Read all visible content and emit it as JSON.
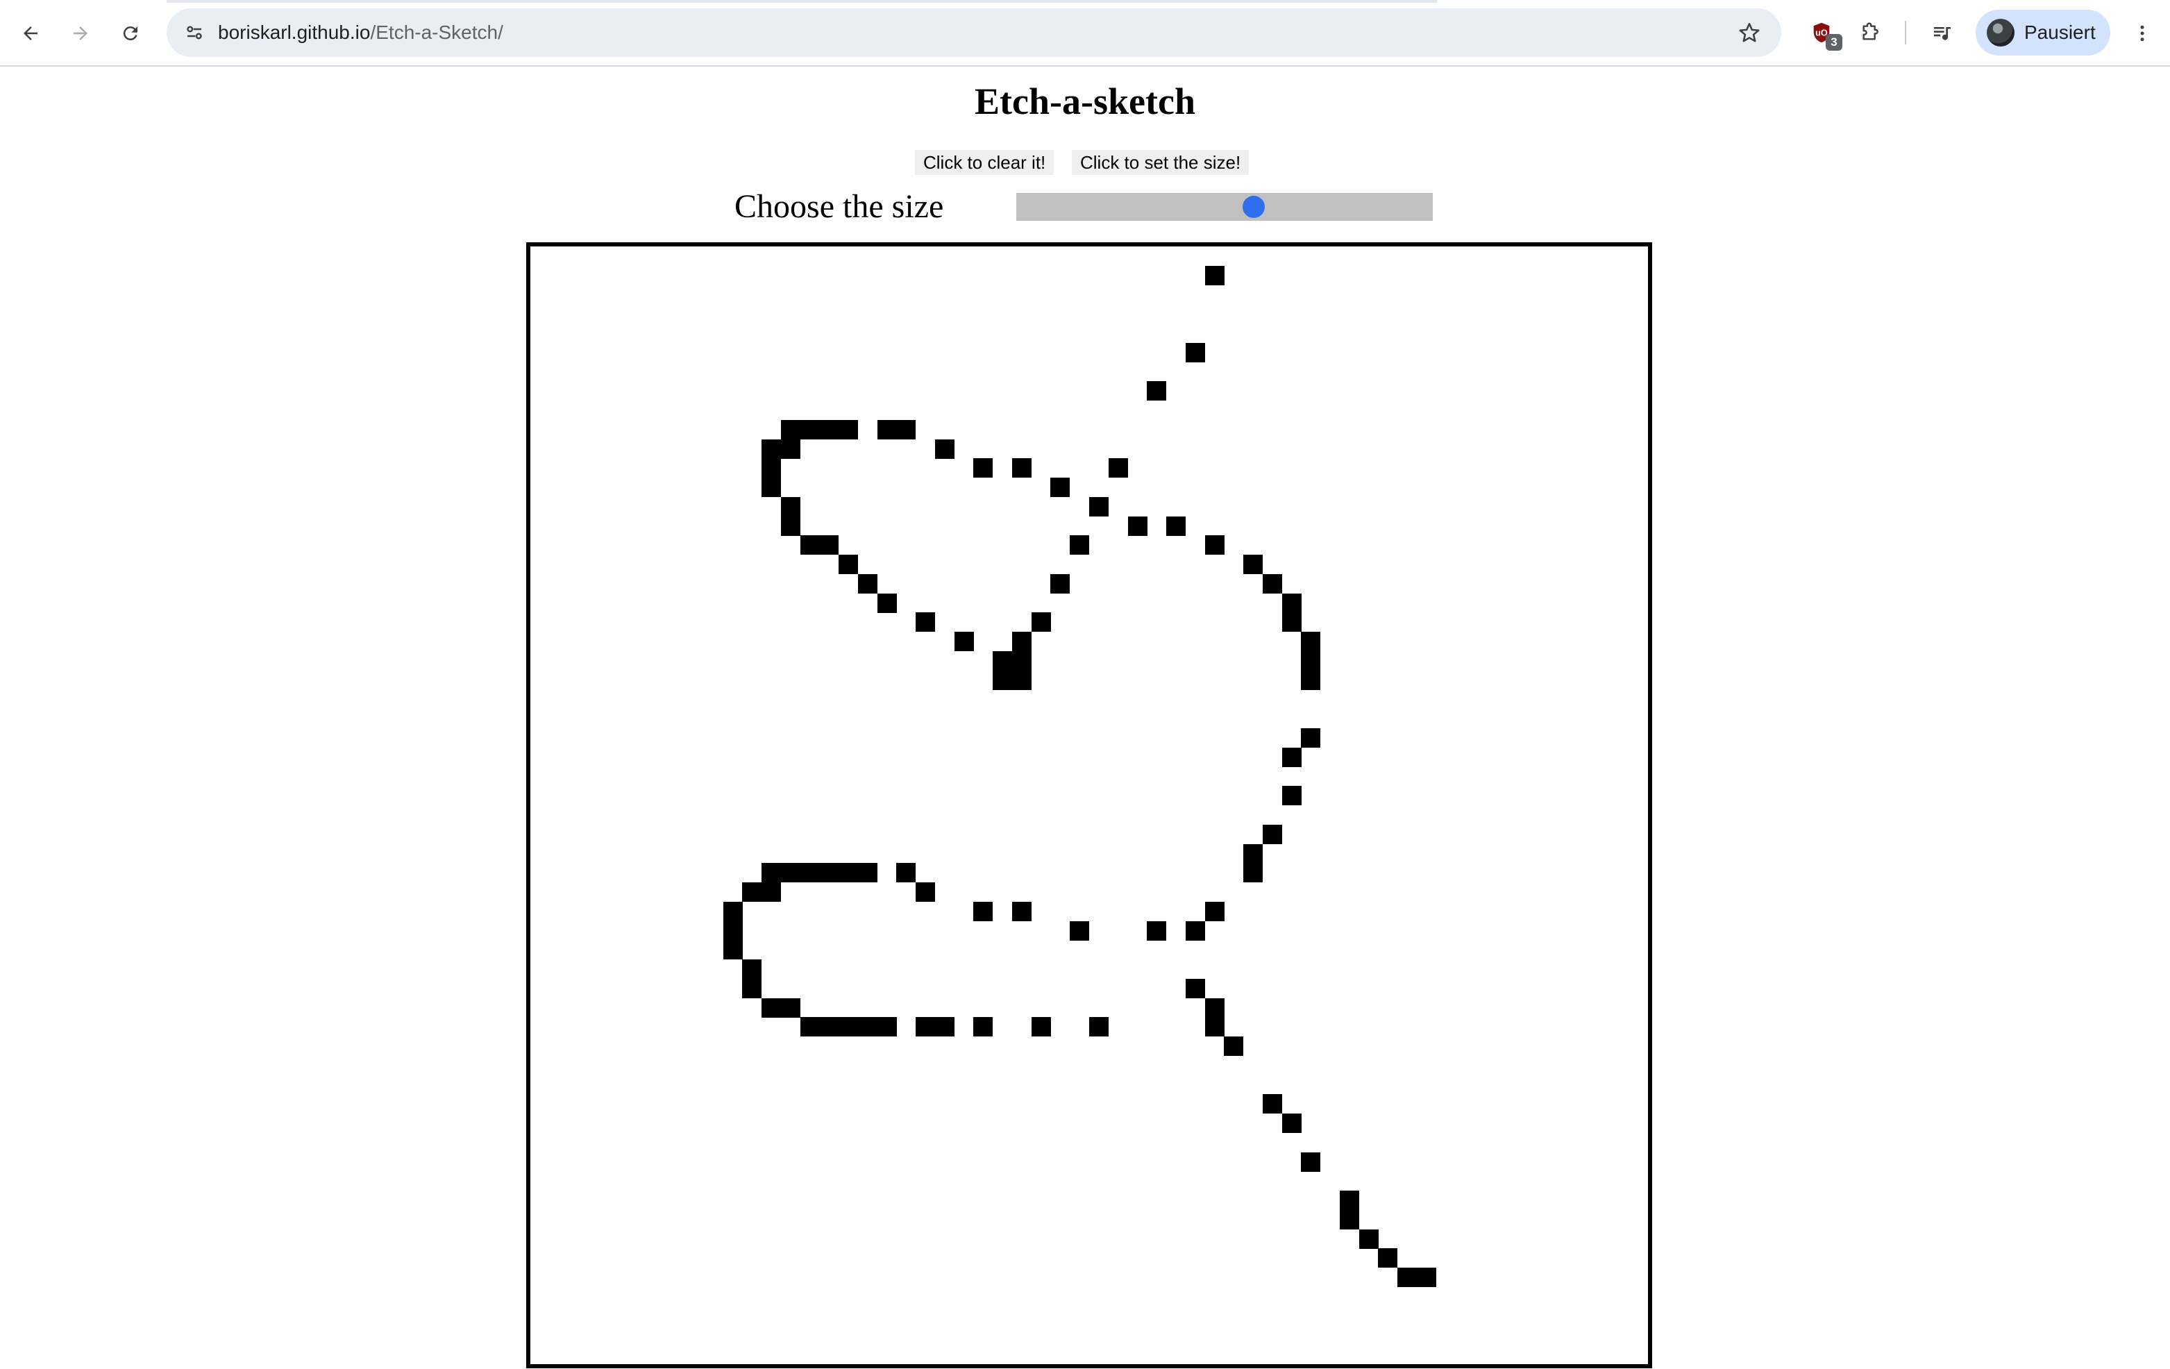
{
  "browser": {
    "url_host": "boriskarl.github.io",
    "url_path": "/Etch-a-Sketch/",
    "extension_badge": "3",
    "profile_name": "Pausiert"
  },
  "page": {
    "title": "Etch-a-sketch",
    "clear_button": "Click to clear it!",
    "set_size_button": "Click to set the size!",
    "size_label": "Choose the size",
    "slider_fraction": 0.57
  },
  "sketch": {
    "grid_size": 58,
    "filled_cells": [
      [
        35,
        1
      ],
      [
        34,
        5
      ],
      [
        32,
        7
      ],
      [
        13,
        9
      ],
      [
        14,
        9
      ],
      [
        15,
        9
      ],
      [
        16,
        9
      ],
      [
        18,
        9
      ],
      [
        19,
        9
      ],
      [
        12,
        10
      ],
      [
        13,
        10
      ],
      [
        21,
        10
      ],
      [
        12,
        11
      ],
      [
        23,
        11
      ],
      [
        25,
        11
      ],
      [
        30,
        11
      ],
      [
        12,
        12
      ],
      [
        27,
        12
      ],
      [
        13,
        13
      ],
      [
        29,
        13
      ],
      [
        31,
        14
      ],
      [
        33,
        14
      ],
      [
        13,
        14
      ],
      [
        14,
        15
      ],
      [
        15,
        15
      ],
      [
        28,
        15
      ],
      [
        35,
        15
      ],
      [
        16,
        16
      ],
      [
        37,
        16
      ],
      [
        17,
        17
      ],
      [
        27,
        17
      ],
      [
        38,
        17
      ],
      [
        18,
        18
      ],
      [
        39,
        18
      ],
      [
        20,
        19
      ],
      [
        26,
        19
      ],
      [
        39,
        19
      ],
      [
        22,
        20
      ],
      [
        25,
        20
      ],
      [
        40,
        20
      ],
      [
        24,
        21
      ],
      [
        25,
        21
      ],
      [
        40,
        21
      ],
      [
        24,
        22
      ],
      [
        25,
        22
      ],
      [
        40,
        22
      ],
      [
        40,
        25
      ],
      [
        39,
        26
      ],
      [
        39,
        28
      ],
      [
        38,
        30
      ],
      [
        37,
        31
      ],
      [
        37,
        32
      ],
      [
        12,
        32
      ],
      [
        13,
        32
      ],
      [
        14,
        32
      ],
      [
        15,
        32
      ],
      [
        16,
        32
      ],
      [
        17,
        32
      ],
      [
        19,
        32
      ],
      [
        11,
        33
      ],
      [
        12,
        33
      ],
      [
        20,
        33
      ],
      [
        10,
        34
      ],
      [
        23,
        34
      ],
      [
        25,
        34
      ],
      [
        35,
        34
      ],
      [
        10,
        35
      ],
      [
        28,
        35
      ],
      [
        32,
        35
      ],
      [
        34,
        35
      ],
      [
        10,
        36
      ],
      [
        11,
        37
      ],
      [
        11,
        38
      ],
      [
        34,
        38
      ],
      [
        12,
        39
      ],
      [
        13,
        39
      ],
      [
        35,
        39
      ],
      [
        14,
        40
      ],
      [
        15,
        40
      ],
      [
        16,
        40
      ],
      [
        17,
        40
      ],
      [
        18,
        40
      ],
      [
        20,
        40
      ],
      [
        21,
        40
      ],
      [
        23,
        40
      ],
      [
        26,
        40
      ],
      [
        29,
        40
      ],
      [
        35,
        40
      ],
      [
        36,
        41
      ],
      [
        38,
        44
      ],
      [
        39,
        45
      ],
      [
        40,
        47
      ],
      [
        42,
        49
      ],
      [
        42,
        50
      ],
      [
        43,
        51
      ],
      [
        44,
        52
      ],
      [
        45,
        53
      ],
      [
        46,
        53
      ]
    ]
  }
}
